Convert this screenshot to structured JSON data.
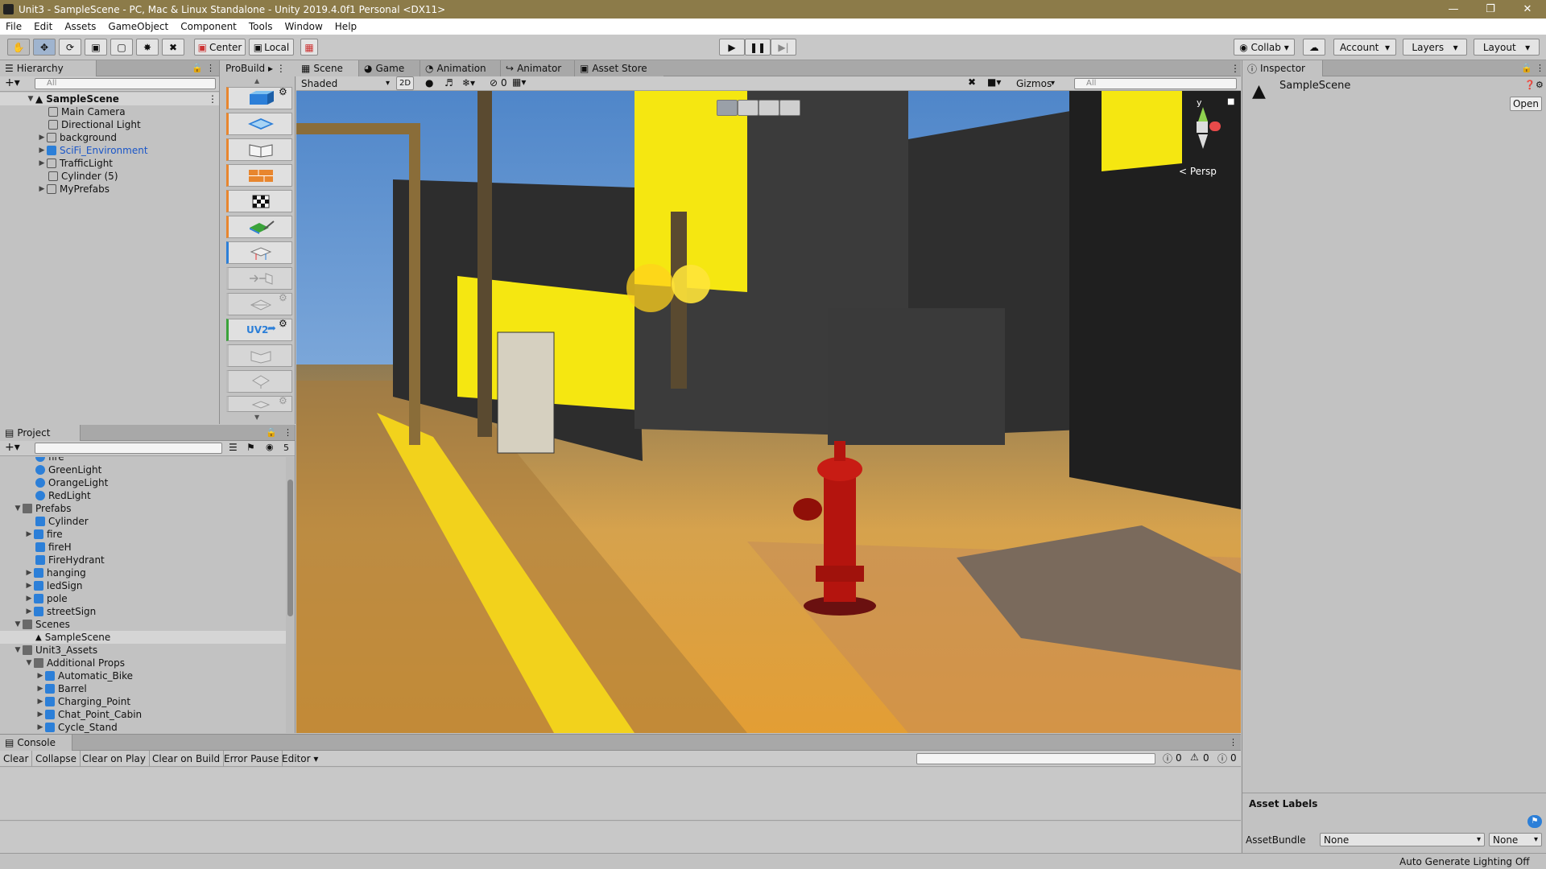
{
  "window": {
    "title": "Unit3 - SampleScene - PC, Mac & Linux Standalone - Unity 2019.4.0f1 Personal <DX11>"
  },
  "menu": [
    "File",
    "Edit",
    "Assets",
    "GameObject",
    "Component",
    "Tools",
    "Window",
    "Help"
  ],
  "toolbar": {
    "pivot": "Center",
    "space": "Local",
    "collab": "Collab",
    "account": "Account",
    "layers": "Layers",
    "layout": "Layout"
  },
  "hierarchy": {
    "tab": "Hierarchy",
    "search_placeholder": "All",
    "scene": "SampleScene",
    "items": [
      "Main Camera",
      "Directional Light",
      "background",
      "SciFi_Environment",
      "TrafficLight",
      "Cylinder (5)",
      "MyPrefabs"
    ]
  },
  "probuilder": {
    "tab": "ProBuild",
    "uv2_label": "UV2"
  },
  "scene_view": {
    "tabs": [
      "Scene",
      "Game",
      "Animation",
      "Animator",
      "Asset Store"
    ],
    "shading": "Shaded",
    "mode_2d": "2D",
    "hidden_count": "0",
    "gizmos": "Gizmos",
    "search_placeholder": "All",
    "persp": "< Persp",
    "axis_y": "y"
  },
  "project": {
    "tab": "Project",
    "hidden_count": "5",
    "items": [
      "fire",
      "GreenLight",
      "OrangeLight",
      "RedLight",
      "Prefabs",
      "Cylinder",
      "fire",
      "fireH",
      "FireHydrant",
      "hanging",
      "ledSign",
      "pole",
      "streetSign",
      "Scenes",
      "SampleScene",
      "Unit3_Assets",
      "Additional Props",
      "Automatic_Bike",
      "Barrel",
      "Charging_Point",
      "Chat_Point_Cabin",
      "Cycle_Stand"
    ]
  },
  "console": {
    "tab": "Console",
    "buttons": [
      "Clear",
      "Collapse",
      "Clear on Play",
      "Clear on Build",
      "Error Pause",
      "Editor"
    ],
    "counts": [
      "0",
      "0",
      "0"
    ]
  },
  "inspector": {
    "tab": "Inspector",
    "object": "SampleScene",
    "open": "Open",
    "asset_labels": "Asset Labels",
    "assetbundle_label": "AssetBundle",
    "assetbundle_value": "None",
    "variant_value": "None"
  },
  "status": {
    "text": "Auto Generate Lighting Off"
  },
  "colors": {
    "title_bar": "#8c7b49",
    "selection_blue": "#2c7fd8",
    "prefab_text": "#1a56c8"
  }
}
